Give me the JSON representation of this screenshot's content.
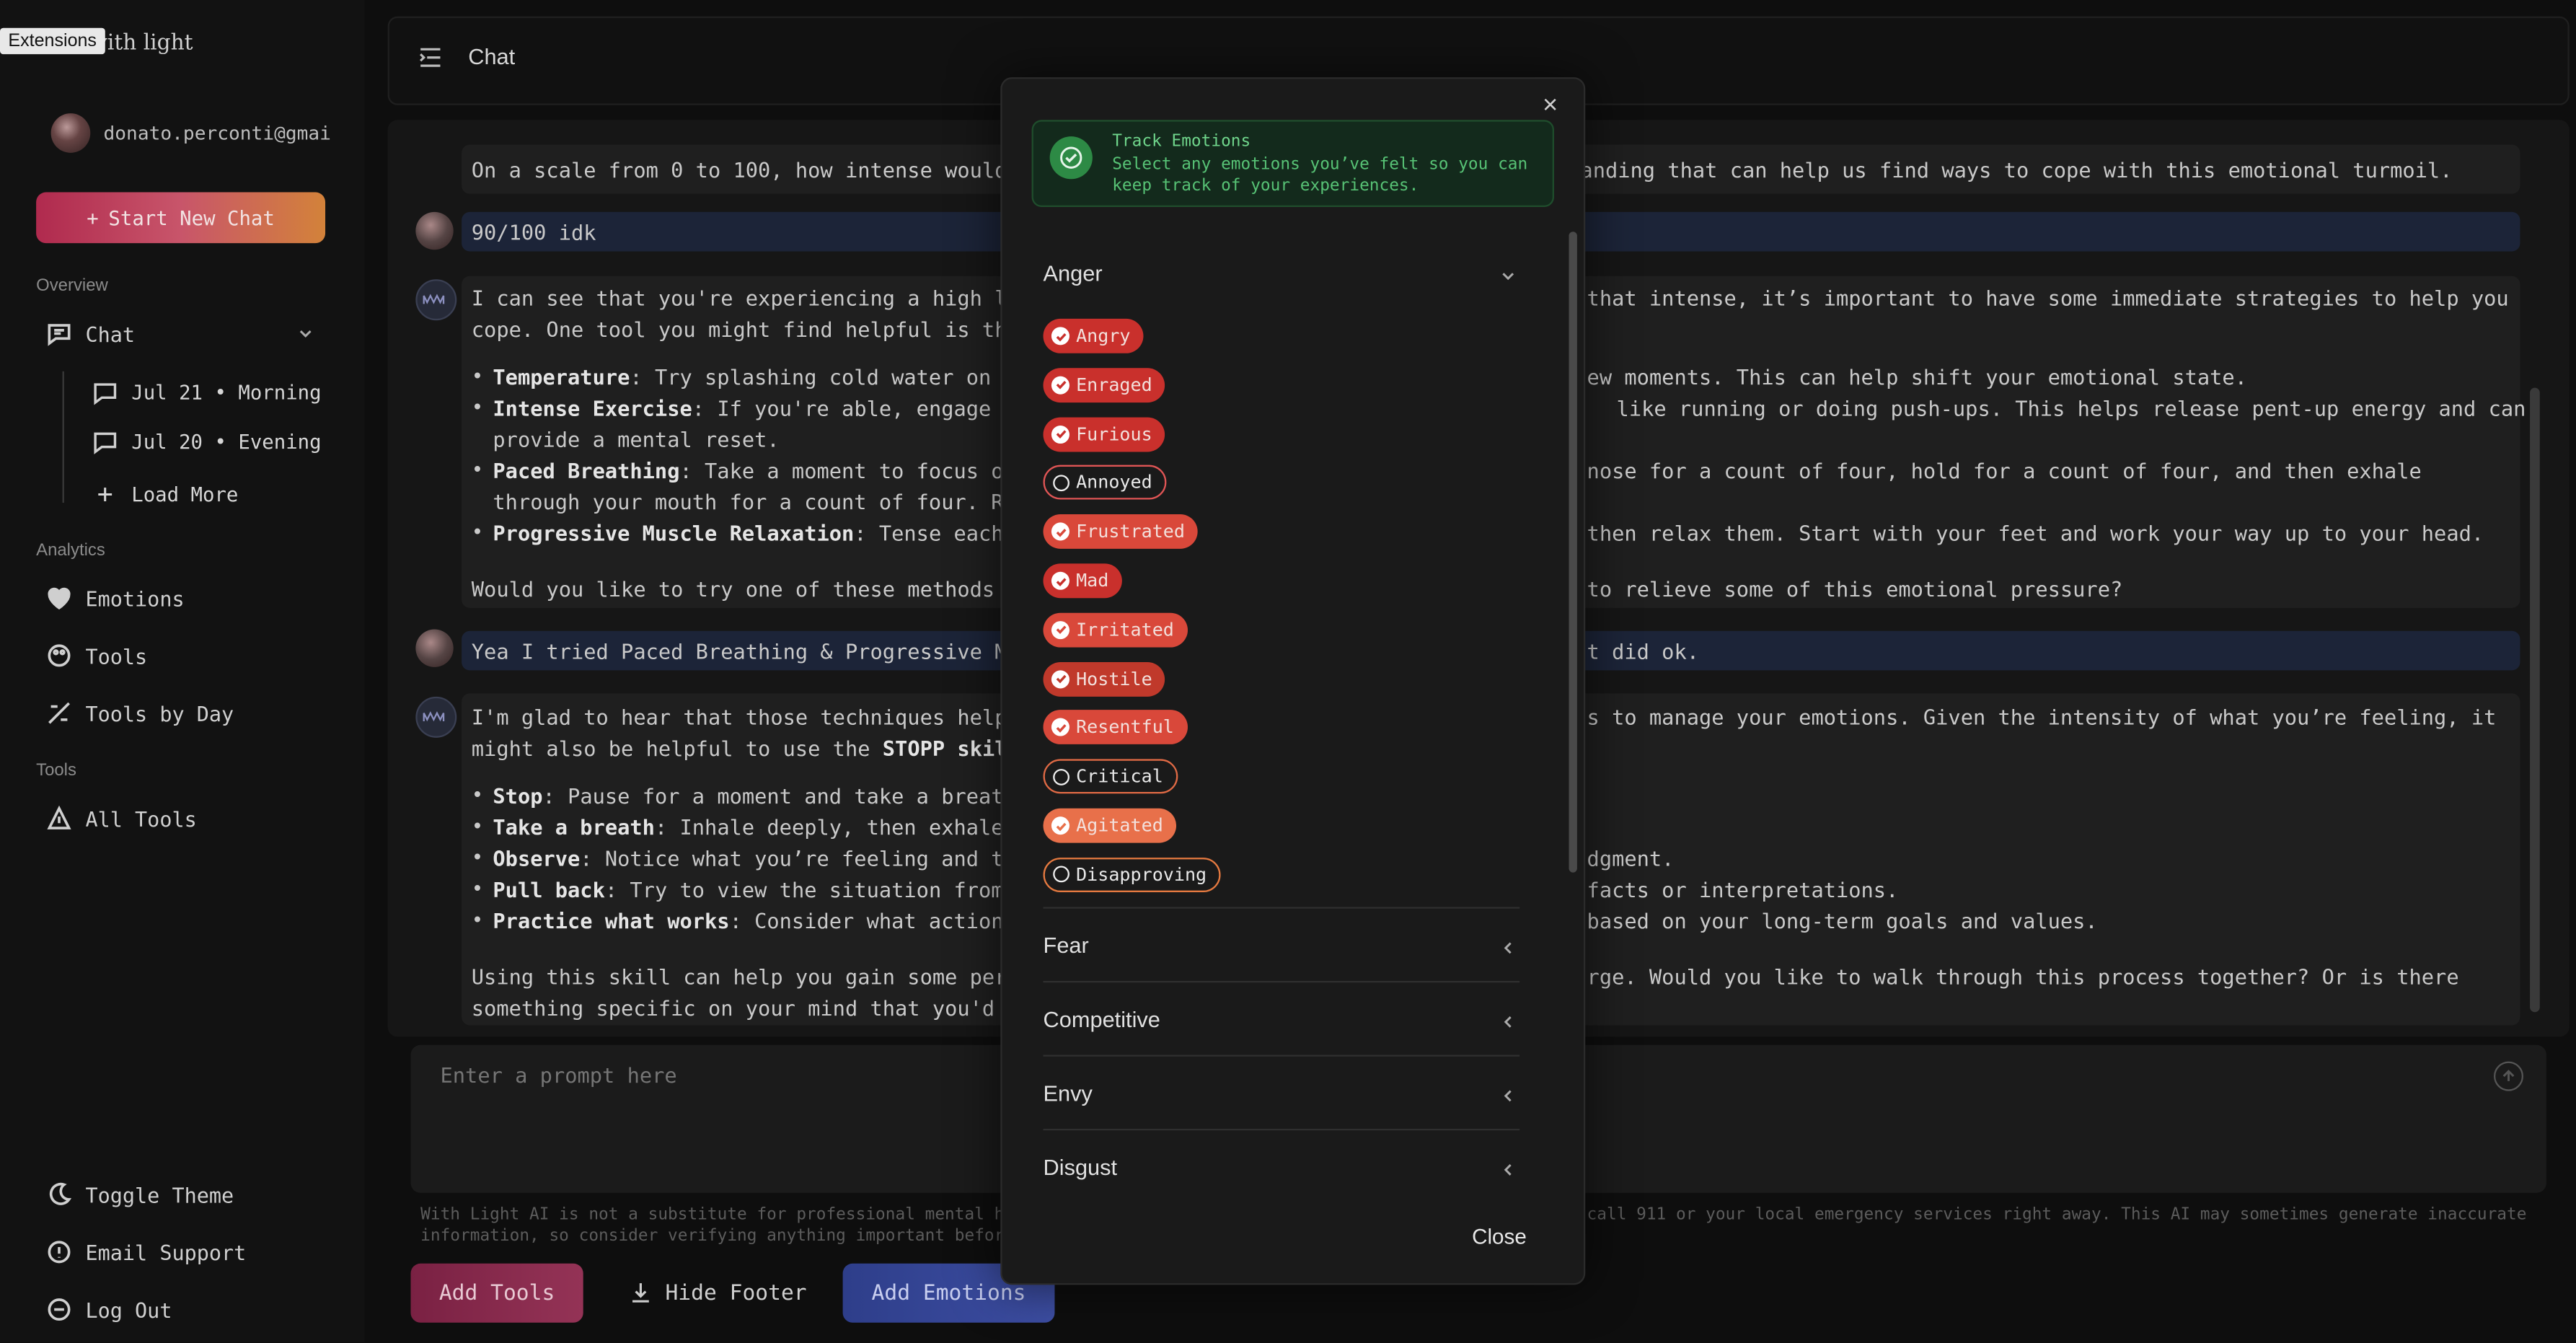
{
  "tooltip": "Extensions",
  "brand": "vith light",
  "user": {
    "email": "donato.perconti@gmai"
  },
  "sidebar": {
    "new_chat": "Start New Chat",
    "overview_label": "Overview",
    "chat_label": "Chat",
    "chat_items": [
      "Jul 21 • Morning",
      "Jul 20 • Evening"
    ],
    "load_more": "Load More",
    "analytics_label": "Analytics",
    "analytics_items": [
      "Emotions",
      "Tools",
      "Tools by Day"
    ],
    "tools_label": "Tools",
    "tools_items": [
      "All Tools"
    ],
    "footer_items": [
      "Toggle Theme",
      "Email Support",
      "Log Out"
    ]
  },
  "header": {
    "title": "Chat"
  },
  "chat": {
    "ai1_line": "On a scale from 0 to 100, how intense would",
    "ai1_line_right": "anding that can help us find ways to cope with this emotional turmoil.",
    "user1": "90/100 idk",
    "ai2_p1_left": "I can see that you're experiencing a high l",
    "ai2_p1_right": "that intense, it’s important to have some immediate strategies to help you",
    "ai2_p1b": "cope. One tool you might find helpful is th",
    "bullets1": [
      {
        "b": "Temperature",
        "t": ": Try splashing cold water on",
        "r": "ew moments. This can help shift your emotional state."
      },
      {
        "b": "Intense Exercise",
        "t": ": If you're able, engage",
        "r": "like running or doing push-ups. This helps release pent-up energy and can"
      },
      {
        "b": "",
        "t": "provide a mental reset.",
        "r": ""
      },
      {
        "b": "Paced Breathing",
        "t": ": Take a moment to focus o",
        "r": "nose for a count of four, hold for a count of four, and then exhale"
      },
      {
        "b": "",
        "t": "through your mouth for a count of four. R",
        "r": ""
      },
      {
        "b": "Progressive Muscle Relaxation",
        "t": ": Tense each",
        "r": "then relax them. Start with your feet and work your way up to your head."
      }
    ],
    "ai2_close_left": "Would you like to try one of these methods",
    "ai2_close_right": "to relieve some of this emotional pressure?",
    "user2_left": "Yea I tried Paced Breathing & Progressive M",
    "user2_right": "t did ok.",
    "ai3_p1_left": "I'm glad to hear that those techniques help",
    "ai3_p1_right": "s to manage your emotions. Given the intensity of what you’re feeling, it",
    "ai3_p1b": "might also be helpful to use the ",
    "ai3_p1b_bold": "STOPP skil",
    "bullets2": [
      {
        "b": "Stop",
        "t": ": Pause for a moment and take a breat",
        "r": ""
      },
      {
        "b": "Take a breath",
        "t": ": Inhale deeply, then exhale",
        "r": ""
      },
      {
        "b": "Observe",
        "t": ": Notice what you’re feeling and t",
        "r": "dgment."
      },
      {
        "b": "Pull back",
        "t": ": Try to view the situation from",
        "r": "facts or interpretations."
      },
      {
        "b": "Practice what works",
        "t": ": Consider what action",
        "r": "based on your long-term goals and values."
      }
    ],
    "ai3_close1_left": "Using this skill can help you gain some per",
    "ai3_close1_right": "rge. Would you like to walk through this process together? Or is there",
    "ai3_close2": "something specific on your mind that you'd"
  },
  "prompt": {
    "placeholder": "Enter a prompt here"
  },
  "disclaimer_left": "With Light AI is not a substitute for professional mental heal",
  "disclaimer_left2": "information, so consider verifying anything important before a",
  "disclaimer_right": "call 911 or your local emergency services right away. This AI may sometimes generate inaccurate",
  "buttons": {
    "add_tools": "Add Tools",
    "hide_footer": "Hide Footer",
    "add_emotions": "Add Emotions"
  },
  "modal": {
    "toast_title": "Track Emotions",
    "toast_text": "Select any emotions you’ve felt so you can keep track of your experiences.",
    "groups": [
      "Anger",
      "Fear",
      "Competitive",
      "Envy",
      "Disgust"
    ],
    "anger_emotions": [
      {
        "label": "Angry",
        "selected": true,
        "color": "#c9302c"
      },
      {
        "label": "Enraged",
        "selected": true,
        "color": "#c9302c"
      },
      {
        "label": "Furious",
        "selected": true,
        "color": "#c9302c"
      },
      {
        "label": "Annoyed",
        "selected": false,
        "color": "#e05555"
      },
      {
        "label": "Frustrated",
        "selected": true,
        "color": "#d9483a"
      },
      {
        "label": "Mad",
        "selected": true,
        "color": "#c9302c"
      },
      {
        "label": "Irritated",
        "selected": true,
        "color": "#d9483a"
      },
      {
        "label": "Hostile",
        "selected": true,
        "color": "#c0392b"
      },
      {
        "label": "Resentful",
        "selected": true,
        "color": "#d9483a"
      },
      {
        "label": "Critical",
        "selected": false,
        "color": "#e06a45"
      },
      {
        "label": "Agitated",
        "selected": true,
        "color": "#e8704a"
      },
      {
        "label": "Disapproving",
        "selected": false,
        "color": "#e67a40"
      }
    ],
    "close": "Close"
  }
}
